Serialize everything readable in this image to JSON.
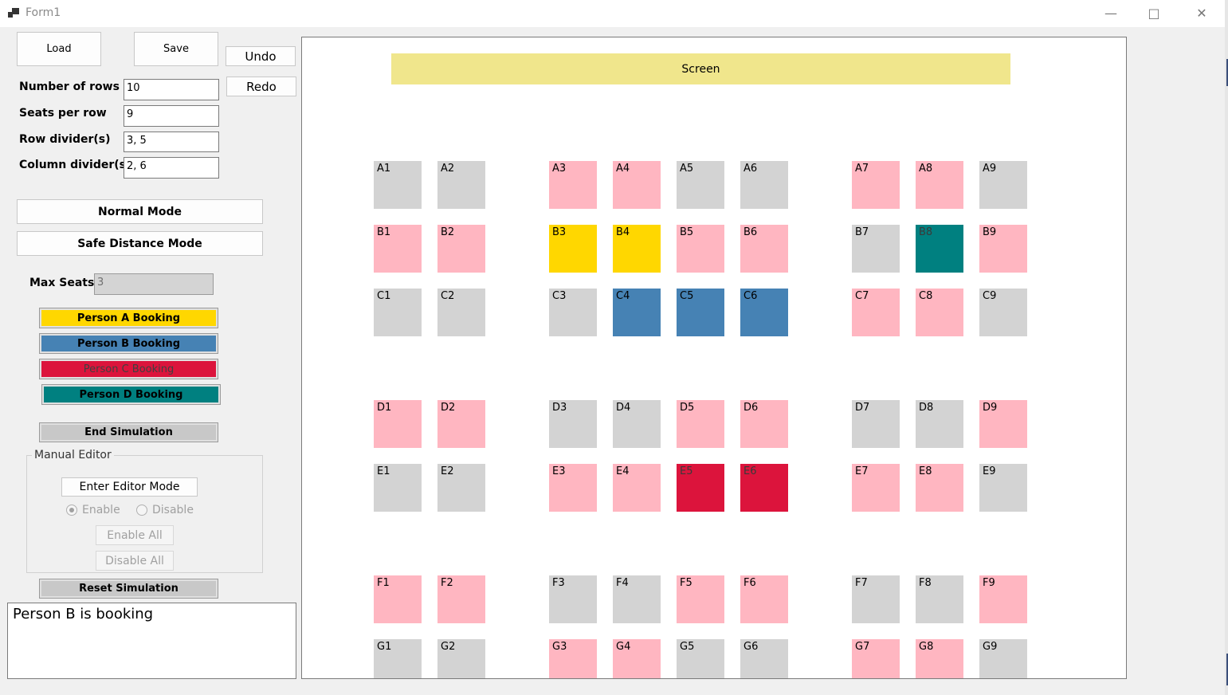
{
  "window": {
    "title": "Form1"
  },
  "toolbar": {
    "load": "Load",
    "save": "Save",
    "undo": "Undo",
    "redo": "Redo"
  },
  "settings": {
    "rows_label": "Number of rows",
    "rows_value": "10",
    "seats_label": "Seats  per row",
    "seats_value": "9",
    "row_dividers_label": "Row divider(s)",
    "row_dividers_value": "3, 5",
    "col_dividers_label": "Column divider(s)",
    "col_dividers_value": "2, 6"
  },
  "modes": {
    "normal": "Normal Mode",
    "safe": "Safe Distance Mode"
  },
  "max_seats": {
    "label": "Max Seats",
    "value": "3"
  },
  "bookings": [
    {
      "label": "Person A Booking",
      "color": "#ffd700",
      "text_color": "#000000"
    },
    {
      "label": "Person B Booking",
      "color": "#4682b4",
      "text_color": "#000000"
    },
    {
      "label": "Person C Booking",
      "color": "#dc143c",
      "text_color": "#404040"
    },
    {
      "label": "Person D Booking",
      "color": "#008080",
      "text_color": "#000000"
    }
  ],
  "simulation": {
    "end": "End Simulation",
    "reset": "Reset Simulation"
  },
  "editor": {
    "group_label": "Manual Editor",
    "enter": "Enter Editor Mode",
    "enable": "Enable",
    "disable": "Disable",
    "enable_all": "Enable All",
    "disable_all": "Disable All"
  },
  "log": {
    "text": "Person B is booking"
  },
  "theater": {
    "screen_label": "Screen",
    "colors": {
      "available": "#d3d3d3",
      "blocked": "#ffb6c1",
      "A": "#ffd700",
      "B": "#4682b4",
      "C": "#dc143c",
      "D": "#008080"
    },
    "rows": [
      {
        "letter": "A",
        "seats": [
          "available",
          "available",
          "blocked",
          "blocked",
          "available",
          "available",
          "blocked",
          "blocked",
          "available"
        ]
      },
      {
        "letter": "B",
        "seats": [
          "blocked",
          "blocked",
          "A",
          "A",
          "blocked",
          "blocked",
          "available",
          "D",
          "blocked"
        ]
      },
      {
        "letter": "C",
        "seats": [
          "available",
          "available",
          "available",
          "B",
          "B",
          "B",
          "blocked",
          "blocked",
          "available"
        ]
      },
      {
        "letter": "D",
        "seats": [
          "blocked",
          "blocked",
          "available",
          "available",
          "blocked",
          "blocked",
          "available",
          "available",
          "blocked"
        ]
      },
      {
        "letter": "E",
        "seats": [
          "available",
          "available",
          "blocked",
          "blocked",
          "C",
          "C",
          "blocked",
          "blocked",
          "available"
        ]
      },
      {
        "letter": "F",
        "seats": [
          "blocked",
          "blocked",
          "available",
          "available",
          "blocked",
          "blocked",
          "available",
          "available",
          "blocked"
        ]
      },
      {
        "letter": "G",
        "seats": [
          "available",
          "available",
          "blocked",
          "blocked",
          "available",
          "available",
          "blocked",
          "blocked",
          "available"
        ]
      }
    ]
  }
}
